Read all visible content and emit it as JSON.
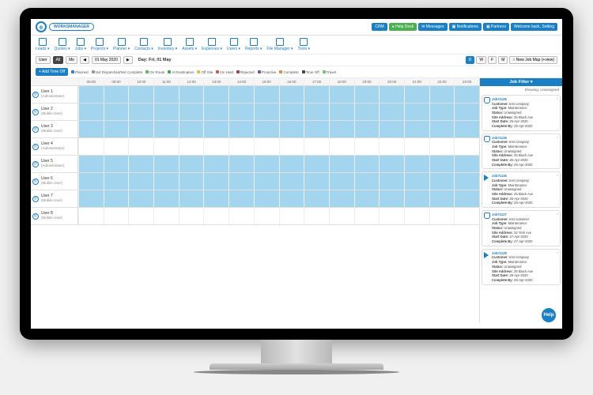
{
  "brand": {
    "initial": "e",
    "name": "WORKSMANAGER"
  },
  "top_pills": [
    {
      "label": "CRM",
      "cls": "b"
    },
    {
      "label": "● Help Desk",
      "cls": "g"
    },
    {
      "label": "✉ Messages",
      "cls": "b"
    },
    {
      "label": "▣ Notifications",
      "cls": "b"
    },
    {
      "label": "▣ Partners",
      "cls": "b"
    },
    {
      "label": "Welcome back, Setting",
      "cls": "b"
    }
  ],
  "menu": [
    "Leads",
    "Quotes",
    "Jobs",
    "Projects",
    "Planner",
    "Contacts",
    "Inventory",
    "Assets",
    "Expenses",
    "Users",
    "Reports",
    "File Manager",
    "Tools"
  ],
  "controls": {
    "user_label": "User",
    "all": "All",
    "me": "Me",
    "date": "01 May 2020",
    "day_label": "Day: Fri, 01 May",
    "views": [
      "D",
      "W",
      "F",
      "M"
    ],
    "new_job": "○ New Job  Map (+view)"
  },
  "legend_button": "+ Add Time Off",
  "legend": [
    {
      "c": "#4477cc",
      "t": "Planned"
    },
    {
      "c": "#999999",
      "t": "Not Dispatched/Not Complete"
    },
    {
      "c": "#5bb85b",
      "t": "On Route"
    },
    {
      "c": "#4aa355",
      "t": "At Destination"
    },
    {
      "c": "#e0c33a",
      "t": "Off Site"
    },
    {
      "c": "#d9534f",
      "t": "On Hold"
    },
    {
      "c": "#b23d3d",
      "t": "Rejected"
    },
    {
      "c": "#7a4fa0",
      "t": "Proactive"
    },
    {
      "c": "#e28a3d",
      "t": "Complete"
    },
    {
      "c": "#444444",
      "t": "Time Off"
    },
    {
      "c": "#6bc96b",
      "t": "Travel"
    }
  ],
  "hours": [
    "08:00",
    "09:00",
    "10:00",
    "11:00",
    "12:00",
    "13:00",
    "14:00",
    "15:00",
    "16:00",
    "17:00",
    "18:00",
    "19:00",
    "20:00",
    "21:00",
    "22:00",
    "23:00"
  ],
  "users": [
    {
      "name": "User 1",
      "role": "(Administrator)",
      "active": true
    },
    {
      "name": "User 2",
      "role": "(Mobile User)",
      "active": true
    },
    {
      "name": "User 3",
      "role": "(Mobile User)",
      "active": true
    },
    {
      "name": "User 4",
      "role": "(Administrator)",
      "active": false
    },
    {
      "name": "User 5",
      "role": "(Administrator)",
      "active": true
    },
    {
      "name": "User 6",
      "role": "(Mobile User)",
      "active": true
    },
    {
      "name": "User 7",
      "role": "(Mobile User)",
      "active": true
    },
    {
      "name": "User 8",
      "role": "(Mobile User)",
      "active": false
    }
  ],
  "sidebar": {
    "title": "Job Filter ▾",
    "showing": "Showing: Unassigned",
    "jobs": [
      {
        "id": "Job#1125",
        "icon": "shield",
        "customer": "test company",
        "type": "Maintenance",
        "status": "Unassigned",
        "addr": "25 Black Ave",
        "start": "25-Apr-2020",
        "complete": "25-Apr-2020"
      },
      {
        "id": "Job#1126",
        "icon": "shield",
        "customer": "test company",
        "type": "Maintenance",
        "status": "Unassigned",
        "addr": "25 Black Ave",
        "start": "25-Apr-2020",
        "complete": "25-Apr-2020"
      },
      {
        "id": "Job#1126",
        "icon": "play",
        "customer": "test company",
        "type": "Maintenance",
        "status": "Unassigned",
        "addr": "25 Black Ave",
        "start": "25-Apr-2020",
        "complete": "25-Apr-2020"
      },
      {
        "id": "Job#1127",
        "icon": "shield",
        "customer": "test customer",
        "type": "Maintenance",
        "status": "Unassigned",
        "addr": "32 York Ave",
        "start": "27-Apr-2020",
        "complete": "27-Apr-2020"
      },
      {
        "id": "Job#1128",
        "icon": "play",
        "customer": "test company",
        "type": "Maintenance",
        "status": "Unassigned",
        "addr": "25 Black Ave",
        "start": "28-Apr-2020",
        "complete": "28-Apr-2020"
      }
    ]
  },
  "labels": {
    "customer": "Customer:",
    "jobtype": "Job Type:",
    "status": "Status:",
    "siteaddr": "Site Address:",
    "startdate": "Start Date:",
    "completeby": "Complete By:"
  },
  "help": "Help"
}
